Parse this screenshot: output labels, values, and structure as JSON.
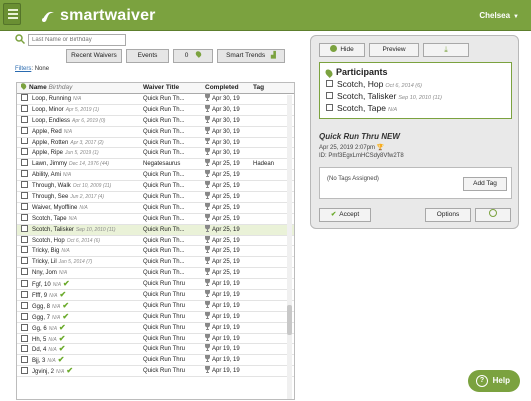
{
  "app": {
    "brand": "smartwaiver",
    "user": "Chelsea"
  },
  "colors": {
    "accent": "#7ba23f",
    "check": "#6aaa2a",
    "selected_row": "#eaf2d8"
  },
  "toolbar": {
    "search_placeholder": "Last Name or Birthday",
    "recent_waivers": "Recent Waivers",
    "events": "Events",
    "count": "0",
    "smart_trends": "Smart Trends"
  },
  "filters": {
    "label": "Filters",
    "value": "None"
  },
  "table": {
    "headers": {
      "name": "Name",
      "birthday": "Birthday",
      "waiver_title": "Waiver Title",
      "completed": "Completed",
      "tag": "Tag"
    },
    "rows": [
      {
        "name": "Loop, Running",
        "bday": "N/A",
        "title": "Quick Run Th...",
        "date": "Apr 30, 19",
        "tag": "",
        "check": false
      },
      {
        "name": "Loop, Minor",
        "bday": "Apr 5, 2019 (1)",
        "title": "Quick Run Th...",
        "date": "Apr 30, 19",
        "tag": "",
        "check": false
      },
      {
        "name": "Loop, Endless",
        "bday": "Apr 6, 2019 (0)",
        "title": "Quick Run Th...",
        "date": "Apr 30, 19",
        "tag": "",
        "check": false
      },
      {
        "name": "Apple, Red",
        "bday": "N/A",
        "title": "Quick Run Th...",
        "date": "Apr 30, 19",
        "tag": "",
        "check": false
      },
      {
        "name": "Apple, Rotten",
        "bday": "Apr 3, 2017 (2)",
        "title": "Quick Run Th...",
        "date": "Apr 30, 19",
        "tag": "",
        "check": false
      },
      {
        "name": "Apple, Ripe",
        "bday": "Jun 5, 2019 (1)",
        "title": "Quick Run Th...",
        "date": "Apr 30, 19",
        "tag": "",
        "check": false
      },
      {
        "name": "Lawn, Jimmy",
        "bday": "Dec 14, 1976 (44)",
        "title": "Negatesaurus",
        "date": "Apr 25, 19",
        "tag": "Hadean",
        "check": false
      },
      {
        "name": "Ability, Ami",
        "bday": "N/A",
        "title": "Quick Run Th...",
        "date": "Apr 25, 19",
        "tag": "",
        "check": false
      },
      {
        "name": "Through, Walk",
        "bday": "Oct 10, 2009 (11)",
        "title": "Quick Run Th...",
        "date": "Apr 25, 19",
        "tag": "",
        "check": false
      },
      {
        "name": "Through, See",
        "bday": "Jun 2, 2017 (4)",
        "title": "Quick Run Th...",
        "date": "Apr 25, 19",
        "tag": "",
        "check": false
      },
      {
        "name": "Waiver, Myoffline",
        "bday": "N/A",
        "title": "Quick Run Th...",
        "date": "Apr 25, 19",
        "tag": "",
        "check": false
      },
      {
        "name": "Scotch, Tape",
        "bday": "N/A",
        "title": "Quick Run Th...",
        "date": "Apr 25, 19",
        "tag": "",
        "check": false
      },
      {
        "name": "Scotch, Talisker",
        "bday": "Sep 10, 2010 (11)",
        "title": "Quick Run Th...",
        "date": "Apr 25, 19",
        "tag": "",
        "check": false,
        "selected": true
      },
      {
        "name": "Scotch, Hop",
        "bday": "Oct 6, 2014 (6)",
        "title": "Quick Run Th...",
        "date": "Apr 25, 19",
        "tag": "",
        "check": false
      },
      {
        "name": "Tricky, Big",
        "bday": "N/A",
        "title": "Quick Run Th...",
        "date": "Apr 25, 19",
        "tag": "",
        "check": false
      },
      {
        "name": "Tricky, Lil",
        "bday": "Jan 5, 2014 (7)",
        "title": "Quick Run Th...",
        "date": "Apr 25, 19",
        "tag": "",
        "check": false
      },
      {
        "name": "Nny, Jom",
        "bday": "N/A",
        "title": "Quick Run Th...",
        "date": "Apr 25, 19",
        "tag": "",
        "check": false
      },
      {
        "name": "Fgf, 10",
        "bday": "N/A",
        "title": "Quick Run Thru",
        "date": "Apr 19, 19",
        "tag": "",
        "check": true
      },
      {
        "name": "Ffff, 9",
        "bday": "N/A",
        "title": "Quick Run Thru",
        "date": "Apr 19, 19",
        "tag": "",
        "check": true
      },
      {
        "name": "Ggg, 8",
        "bday": "N/A",
        "title": "Quick Run Thru",
        "date": "Apr 19, 19",
        "tag": "",
        "check": true
      },
      {
        "name": "Ggg, 7",
        "bday": "N/A",
        "title": "Quick Run Thru",
        "date": "Apr 19, 19",
        "tag": "",
        "check": true
      },
      {
        "name": "Gg, 6",
        "bday": "N/A",
        "title": "Quick Run Thru",
        "date": "Apr 19, 19",
        "tag": "",
        "check": true
      },
      {
        "name": "Hh, 5",
        "bday": "N/A",
        "title": "Quick Run Thru",
        "date": "Apr 19, 19",
        "tag": "",
        "check": true
      },
      {
        "name": "Dd, 4",
        "bday": "N/A",
        "title": "Quick Run Thru",
        "date": "Apr 19, 19",
        "tag": "",
        "check": true
      },
      {
        "name": "Bjj, 3",
        "bday": "N/A",
        "title": "Quick Run Thru",
        "date": "Apr 19, 19",
        "tag": "",
        "check": true
      },
      {
        "name": "Jgvinj, 2",
        "bday": "N/A",
        "title": "Quick Run Thru",
        "date": "Apr 19, 19",
        "tag": "",
        "check": true
      }
    ]
  },
  "panel": {
    "hide": "Hide",
    "preview": "Preview",
    "participants_title": "Participants",
    "participants": [
      {
        "name": "Scotch, Hop",
        "bday": "Oct 6, 2014 (6)"
      },
      {
        "name": "Scotch, Talisker",
        "bday": "Sep 10, 2010 (11)"
      },
      {
        "name": "Scotch, Tape",
        "bday": "N/A"
      }
    ],
    "waiver_title": "Quick Run Thru NEW",
    "waiver_date": "Apr 25, 2019 2:07pm",
    "waiver_id": "ID: Pmf3EgxLmHCSdy8Vfw2T8",
    "no_tags": "(No Tags Assigned)",
    "add_tag": "Add Tag",
    "accept": "Accept",
    "options": "Options"
  },
  "help": {
    "label": "Help"
  }
}
